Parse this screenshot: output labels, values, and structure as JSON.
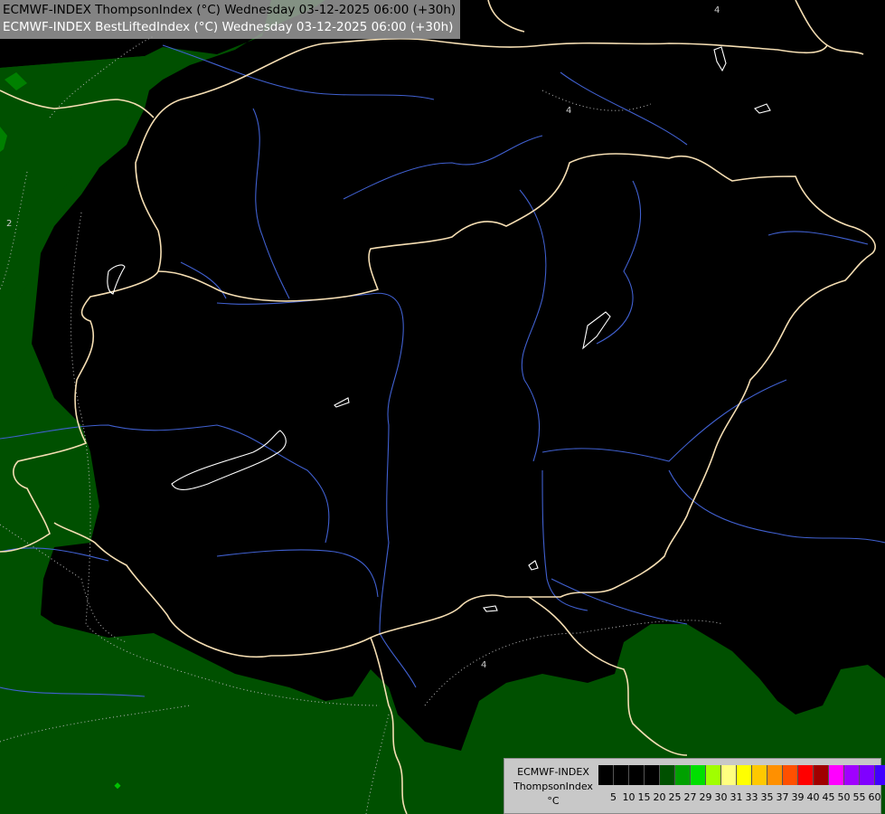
{
  "map": {
    "model": "ECMWF-INDEX",
    "titles": [
      "ECMWF-INDEX ThompsonIndex (°C) Wednesday 03-12-2025 06:00 (+30h)",
      "ECMWF-INDEX BestLiftedIndex (°C) Wednesday 03-12-2025 06:00 (+30h)"
    ],
    "contour_labels": [
      "2",
      "4",
      "4",
      "4"
    ],
    "colors": {
      "background": "#000000",
      "shade_20_25": "#005000",
      "shade_25_27": "#008000",
      "border": "#f5deb3",
      "river": "#4060d0",
      "lake": "#ffffff",
      "contour": "#bbbbbb"
    }
  },
  "legend": {
    "title": "ECMWF-INDEX",
    "parameter": "ThompsonIndex",
    "unit": "°C",
    "colors": [
      "#000000",
      "#000000",
      "#000000",
      "#000000",
      "#005000",
      "#00a000",
      "#00e000",
      "#a0ff00",
      "#ffff80",
      "#ffff00",
      "#ffc800",
      "#ff9000",
      "#ff5000",
      "#ff0000",
      "#a00000",
      "#ff00ff",
      "#a000ff",
      "#8000ff",
      "#4000ff",
      "#0000ff"
    ],
    "ticks": [
      "5",
      "10",
      "15",
      "20",
      "25",
      "27",
      "29",
      "30",
      "31",
      "33",
      "35",
      "37",
      "39",
      "40",
      "45",
      "50",
      "55",
      "60"
    ]
  }
}
